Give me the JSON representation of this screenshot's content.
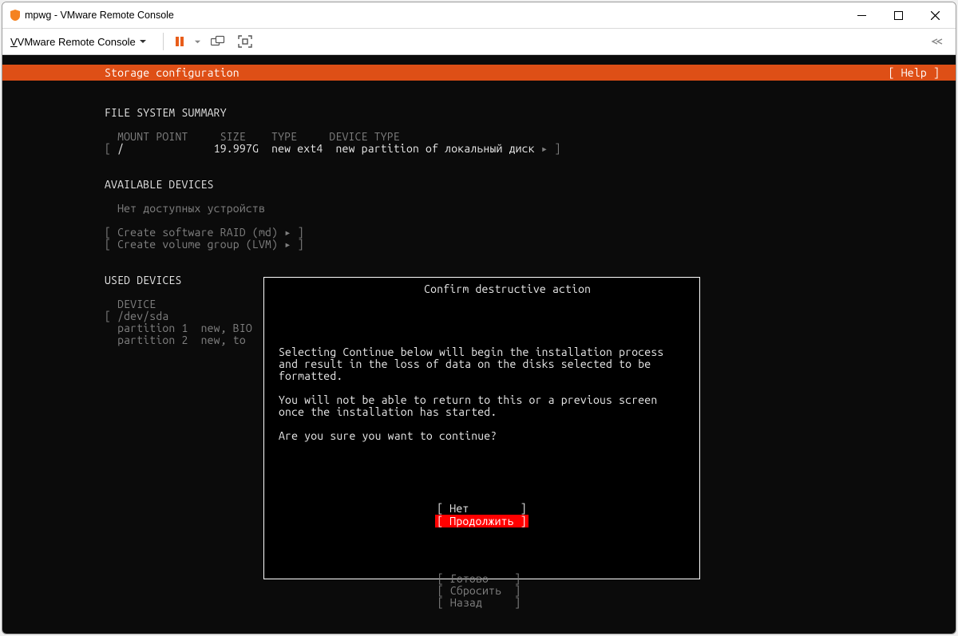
{
  "window": {
    "title": "mpwg - VMware Remote Console"
  },
  "toolbar": {
    "menu_label": "VMware Remote Console"
  },
  "header": {
    "title": "Storage configuration",
    "help": "[ Help ]"
  },
  "sections": {
    "file_system_summary": "FILE SYSTEM SUMMARY",
    "columns": "  MOUNT POINT     SIZE    TYPE     DEVICE TYPE",
    "row1_open": "[ ",
    "row1_mount": "/",
    "row1_size": "19.997G",
    "row1_type": "new ext4",
    "row1_dev": "new partition of локальный диск",
    "row1_close": " ▸ ]",
    "available_devices": "AVAILABLE DEVICES",
    "no_devices": "  Нет доступных устройств",
    "raid": "[ Create software RAID (md) ▸ ]",
    "lvm": "[ Create volume group (LVM) ▸ ]",
    "used_devices": "USED DEVICES",
    "device_col": "  DEVICE",
    "dev_row": "[ /dev/sda",
    "part1": "  partition 1  new, BIO",
    "part2": "  partition 2  new, to"
  },
  "dialog": {
    "title": "Confirm destructive action",
    "p1": "Selecting Continue below will begin the installation process and result in the loss of data on the disks selected to be formatted.",
    "p2": "You will not be able to return to this or a previous screen once the installation has started.",
    "p3": "Are you sure you want to continue?",
    "no": "[ Нет        ]",
    "cont": "[ Продолжить ]"
  },
  "bottom": {
    "done": "[ Готово    ]",
    "reset": "[ Сбросить  ]",
    "back": "[ Назад     ]"
  }
}
